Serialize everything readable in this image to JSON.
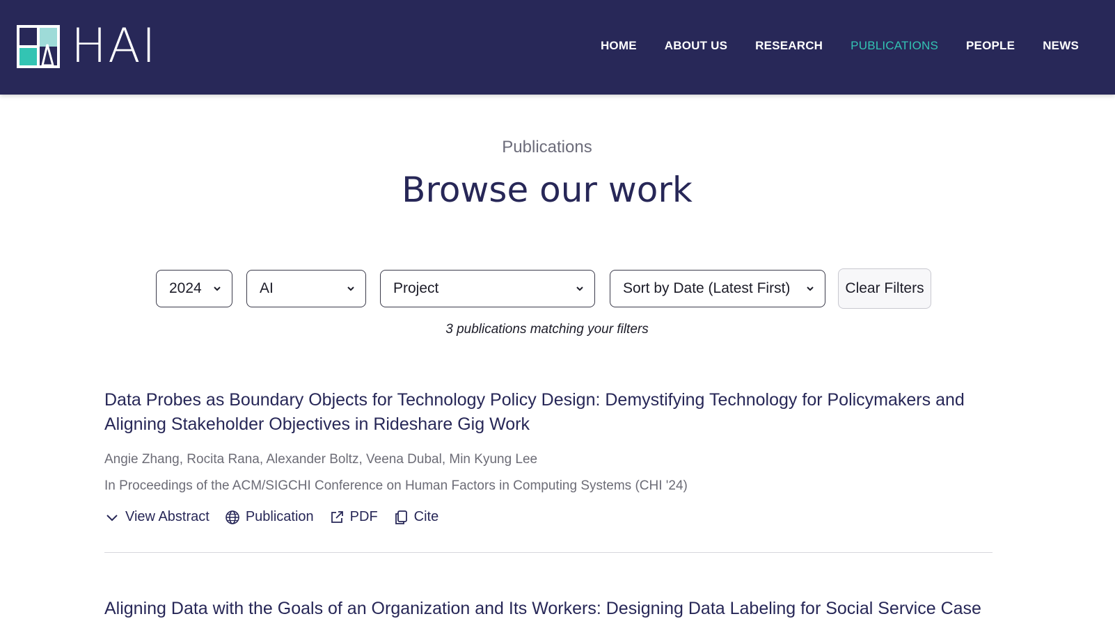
{
  "header": {
    "logo_text": "HAI",
    "nav": [
      {
        "label": "HOME",
        "active": false
      },
      {
        "label": "ABOUT US",
        "active": false
      },
      {
        "label": "RESEARCH",
        "active": false
      },
      {
        "label": "PUBLICATIONS",
        "active": true
      },
      {
        "label": "PEOPLE",
        "active": false
      },
      {
        "label": "NEWS",
        "active": false
      }
    ],
    "accent_color": "#33c4b3",
    "background_color": "#282858"
  },
  "page": {
    "eyebrow": "Publications",
    "title": "Browse our work"
  },
  "filters": {
    "year": "2024",
    "topic": "AI",
    "project": "Project",
    "sort": "Sort by Date (Latest First)",
    "clear_label": "Clear Filters",
    "result_count": "3 publications matching your filters"
  },
  "publications": [
    {
      "title": "Data Probes as Boundary Objects for Technology Policy Design: Demystifying Technology for Policymakers and Aligning Stakeholder Objectives in Rideshare Gig Work",
      "authors": "Angie Zhang, Rocita Rana, Alexander Boltz, Veena Dubal, Min Kyung Lee",
      "venue": "In Proceedings of the ACM/SIGCHI Conference on Human Factors in Computing Systems (CHI '24)",
      "actions": {
        "abstract": "View Abstract",
        "publication": "Publication",
        "pdf": "PDF",
        "cite": "Cite"
      }
    },
    {
      "title": "Aligning Data with the Goals of an Organization and Its Workers: Designing Data Labeling for Social Service Case"
    }
  ]
}
